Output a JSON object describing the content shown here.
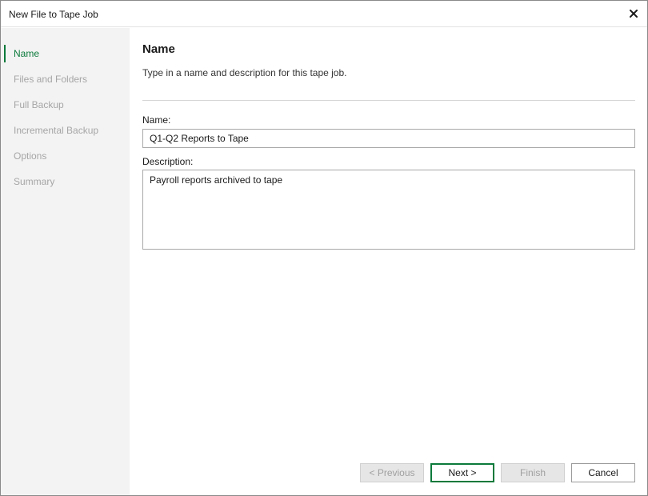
{
  "window": {
    "title": "New File to Tape Job",
    "close_icon": "close-icon"
  },
  "sidebar": {
    "active": 0,
    "items": [
      {
        "label": "Name"
      },
      {
        "label": "Files and Folders"
      },
      {
        "label": "Full Backup"
      },
      {
        "label": "Incremental Backup"
      },
      {
        "label": "Options"
      },
      {
        "label": "Summary"
      }
    ]
  },
  "main": {
    "heading": "Name",
    "subtext": "Type in a name and description for this tape job.",
    "name_label": "Name:",
    "name_value": "Q1-Q2 Reports to Tape",
    "description_label": "Description:",
    "description_value": "Payroll reports archived to tape"
  },
  "buttons": {
    "previous": "< Previous",
    "next": "Next >",
    "finish": "Finish",
    "cancel": "Cancel"
  },
  "colors": {
    "accent": "#0b7a3b",
    "sidebar_bg": "#f3f3f3",
    "inactive_nav": "#a6a6a6"
  }
}
